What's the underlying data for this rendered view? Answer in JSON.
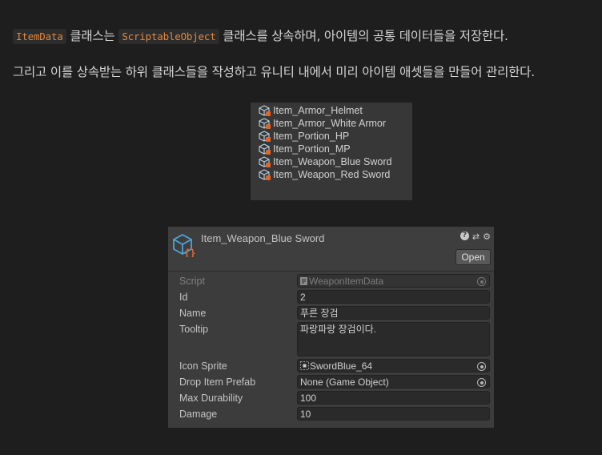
{
  "intro": {
    "line1": {
      "code1": "ItemData",
      "text1": " 클래스는 ",
      "code2": "ScriptableObject",
      "text2": " 클래스를 상속하며, 아이템의 공통 데이터들을 저장한다."
    },
    "line2": "그리고 이를 상속받는 하위 클래스들을 작성하고 유니티 내에서 미리 아이템 애셋들을 만들어 관리한다."
  },
  "assets": [
    "Item_Armor_Helmet",
    "Item_Armor_White Armor",
    "Item_Portion_HP",
    "Item_Portion_MP",
    "Item_Weapon_Blue Sword",
    "Item_Weapon_Red Sword"
  ],
  "inspector": {
    "title": "Item_Weapon_Blue Sword",
    "header_icons": {
      "help": "?",
      "presets": "⇄",
      "settings": "⚙"
    },
    "open_label": "Open",
    "fields": {
      "script": {
        "label": "Script",
        "value": "WeaponItemData"
      },
      "id": {
        "label": "Id",
        "value": "2"
      },
      "name": {
        "label": "Name",
        "value": "푸른 장검"
      },
      "tooltip": {
        "label": "Tooltip",
        "value": "파랑파랑 장검이다."
      },
      "icon_sprite": {
        "label": "Icon Sprite",
        "value": "SwordBlue_64"
      },
      "drop_item_prefab": {
        "label": "Drop Item Prefab",
        "value": "None (Game Object)"
      },
      "max_durability": {
        "label": "Max Durability",
        "value": "100"
      },
      "damage": {
        "label": "Damage",
        "value": "10"
      }
    }
  },
  "colors": {
    "background": "#1e1e1e",
    "inline_code": "#e2863e",
    "icon_blue": "#4fa3d9",
    "icon_orange": "#e0662a"
  }
}
